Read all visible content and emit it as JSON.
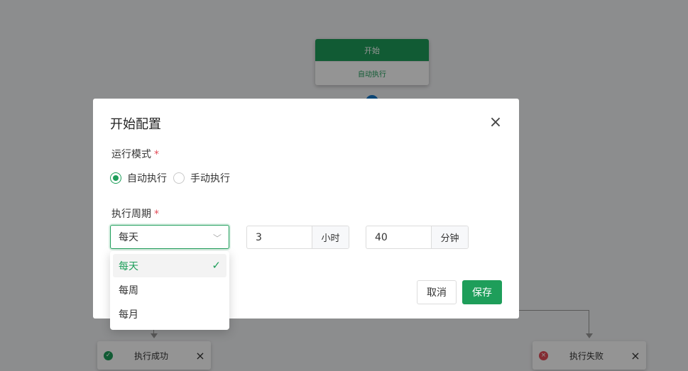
{
  "flow": {
    "start_node": {
      "title": "开始",
      "mode": "自动执行"
    },
    "success_node": {
      "label": "执行成功",
      "status_icon": "check-circle-icon",
      "status_color": "#1e9e5a"
    },
    "fail_node": {
      "label": "执行失败",
      "status_icon": "error-circle-icon",
      "status_color": "#e34d59"
    }
  },
  "modal": {
    "title": "开始配置",
    "run_mode": {
      "label": "运行模式",
      "required_mark": "*",
      "options": [
        {
          "label": "自动执行",
          "checked": true
        },
        {
          "label": "手动执行",
          "checked": false
        }
      ]
    },
    "period": {
      "label": "执行周期",
      "required_mark": "*",
      "frequency": "每天",
      "hour_value": "3",
      "hour_unit": "小时",
      "minute_value": "40",
      "minute_unit": "分钟"
    },
    "buttons": {
      "cancel": "取消",
      "save": "保存"
    }
  },
  "dropdown": {
    "options": [
      {
        "label": "每天",
        "selected": true
      },
      {
        "label": "每周",
        "selected": false
      },
      {
        "label": "每月",
        "selected": false
      }
    ]
  },
  "colors": {
    "primary": "#1e9e5a",
    "error": "#e34d59",
    "connector": "#1677c9"
  }
}
